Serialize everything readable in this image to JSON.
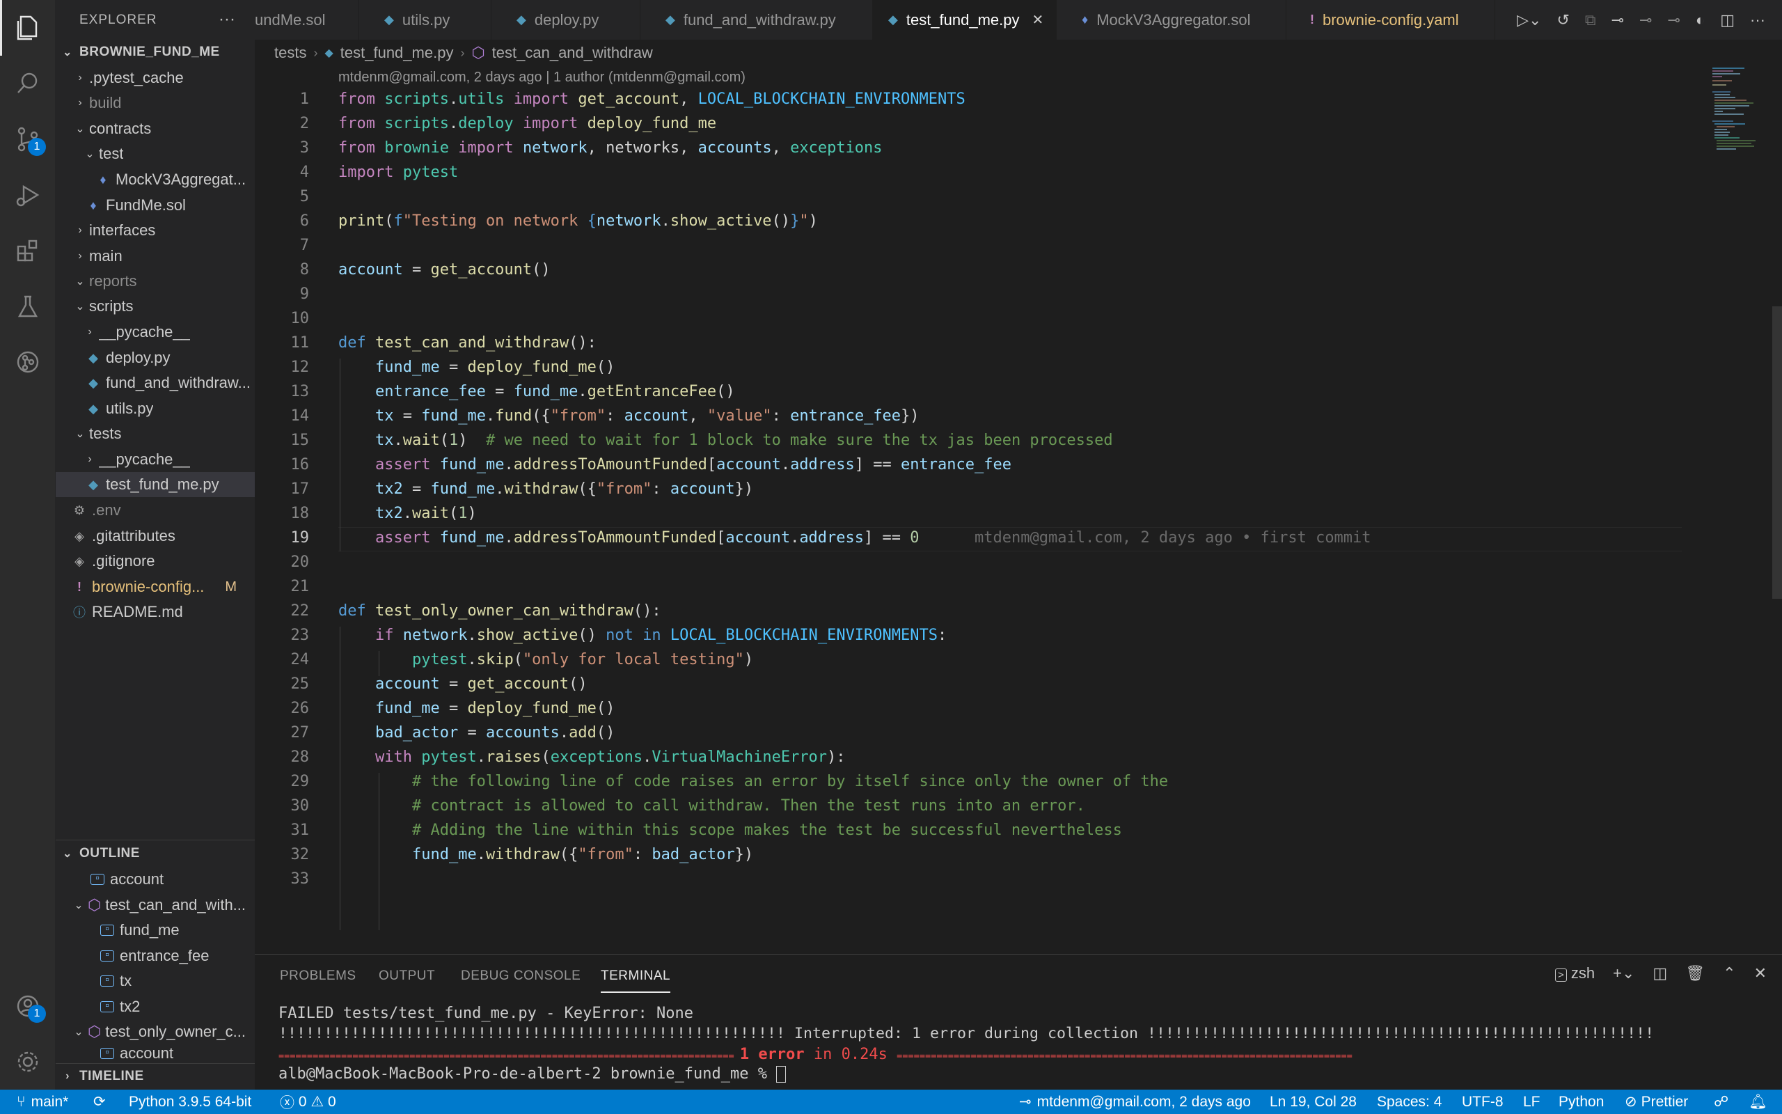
{
  "activity_bar": {
    "scm_badge": "1",
    "accounts_badge": "1"
  },
  "sidebar": {
    "title": "EXPLORER",
    "more": "···",
    "root": "BROWNIE_FUND_ME",
    "items": [
      {
        "label": ".pytest_cache"
      },
      {
        "label": "build"
      },
      {
        "label": "contracts"
      },
      {
        "label": "test"
      },
      {
        "label": "MockV3Aggregat..."
      },
      {
        "label": "FundMe.sol"
      },
      {
        "label": "interfaces"
      },
      {
        "label": "main"
      },
      {
        "label": "reports"
      },
      {
        "label": "scripts"
      },
      {
        "label": "__pycache__"
      },
      {
        "label": "deploy.py"
      },
      {
        "label": "fund_and_withdraw..."
      },
      {
        "label": "utils.py"
      },
      {
        "label": "tests"
      },
      {
        "label": "__pycache__"
      },
      {
        "label": "test_fund_me.py"
      },
      {
        "label": ".env"
      },
      {
        "label": ".gitattributes"
      },
      {
        "label": ".gitignore"
      },
      {
        "label": "brownie-config...",
        "badge": "M"
      },
      {
        "label": "README.md"
      }
    ],
    "outline": {
      "title": "OUTLINE",
      "items": [
        {
          "label": "account"
        },
        {
          "label": "test_can_and_with..."
        },
        {
          "label": "fund_me"
        },
        {
          "label": "entrance_fee"
        },
        {
          "label": "tx"
        },
        {
          "label": "tx2"
        },
        {
          "label": "test_only_owner_c..."
        },
        {
          "label": "account"
        }
      ]
    },
    "timeline": "TIMELINE"
  },
  "tabs": [
    {
      "label": "undMe.sol"
    },
    {
      "label": "utils.py"
    },
    {
      "label": "deploy.py"
    },
    {
      "label": "fund_and_withdraw.py"
    },
    {
      "label": "test_fund_me.py"
    },
    {
      "label": "MockV3Aggregator.sol"
    },
    {
      "label": "brownie-config.yaml"
    }
  ],
  "breadcrumb": [
    "tests",
    "test_fund_me.py",
    "test_can_and_withdraw"
  ],
  "editor": {
    "blame_header": "mtdenm@gmail.com, 2 days ago | 1 author (mtdenm@gmail.com)",
    "inline_blame": "mtdenm@gmail.com, 2 days ago • first commit",
    "line_numbers": [
      "1",
      "2",
      "3",
      "4",
      "5",
      "6",
      "7",
      "8",
      "9",
      "10",
      "11",
      "12",
      "13",
      "14",
      "15",
      "16",
      "17",
      "18",
      "19",
      "20",
      "21",
      "22",
      "23",
      "24",
      "25",
      "26",
      "27",
      "28",
      "29",
      "30",
      "31",
      "32",
      "33"
    ]
  },
  "panel": {
    "tabs": [
      "PROBLEMS",
      "OUTPUT",
      "DEBUG CONSOLE",
      "TERMINAL"
    ],
    "shell": "zsh",
    "terminal": {
      "line1": "FAILED tests/test_fund_me.py - KeyError: None",
      "line2": "!!!!!!!!!!!!!!!!!!!!!!!!!!!!!!!!!!!!!!!!!!!!!!!!!!!!!!!! Interrupted: 1 error during collection !!!!!!!!!!!!!!!!!!!!!!!!!!!!!!!!!!!!!!!!!!!!!!!!!!!!!!!!",
      "line3_left": "================================================================================",
      "line3_mid1": "1 error",
      "line3_mid2": " in 0.24s ",
      "line3_right": "================================================================================",
      "prompt": "alb@MacBook-MacBook-Pro-de-albert-2 brownie_fund_me % "
    }
  },
  "status_bar": {
    "branch": "main*",
    "python": "Python 3.9.5 64-bit",
    "errors": "0",
    "warnings": "0",
    "blame": "mtdenm@gmail.com, 2 days ago",
    "position": "Ln 19, Col 28",
    "spaces": "Spaces: 4",
    "encoding": "UTF-8",
    "eol": "LF",
    "language": "Python",
    "formatter": "Prettier"
  },
  "colors": {
    "status_bar": "#007acc",
    "sidebar": "#252526",
    "editor": "#1e1e1e",
    "activity_bar": "#2c2c2c"
  }
}
